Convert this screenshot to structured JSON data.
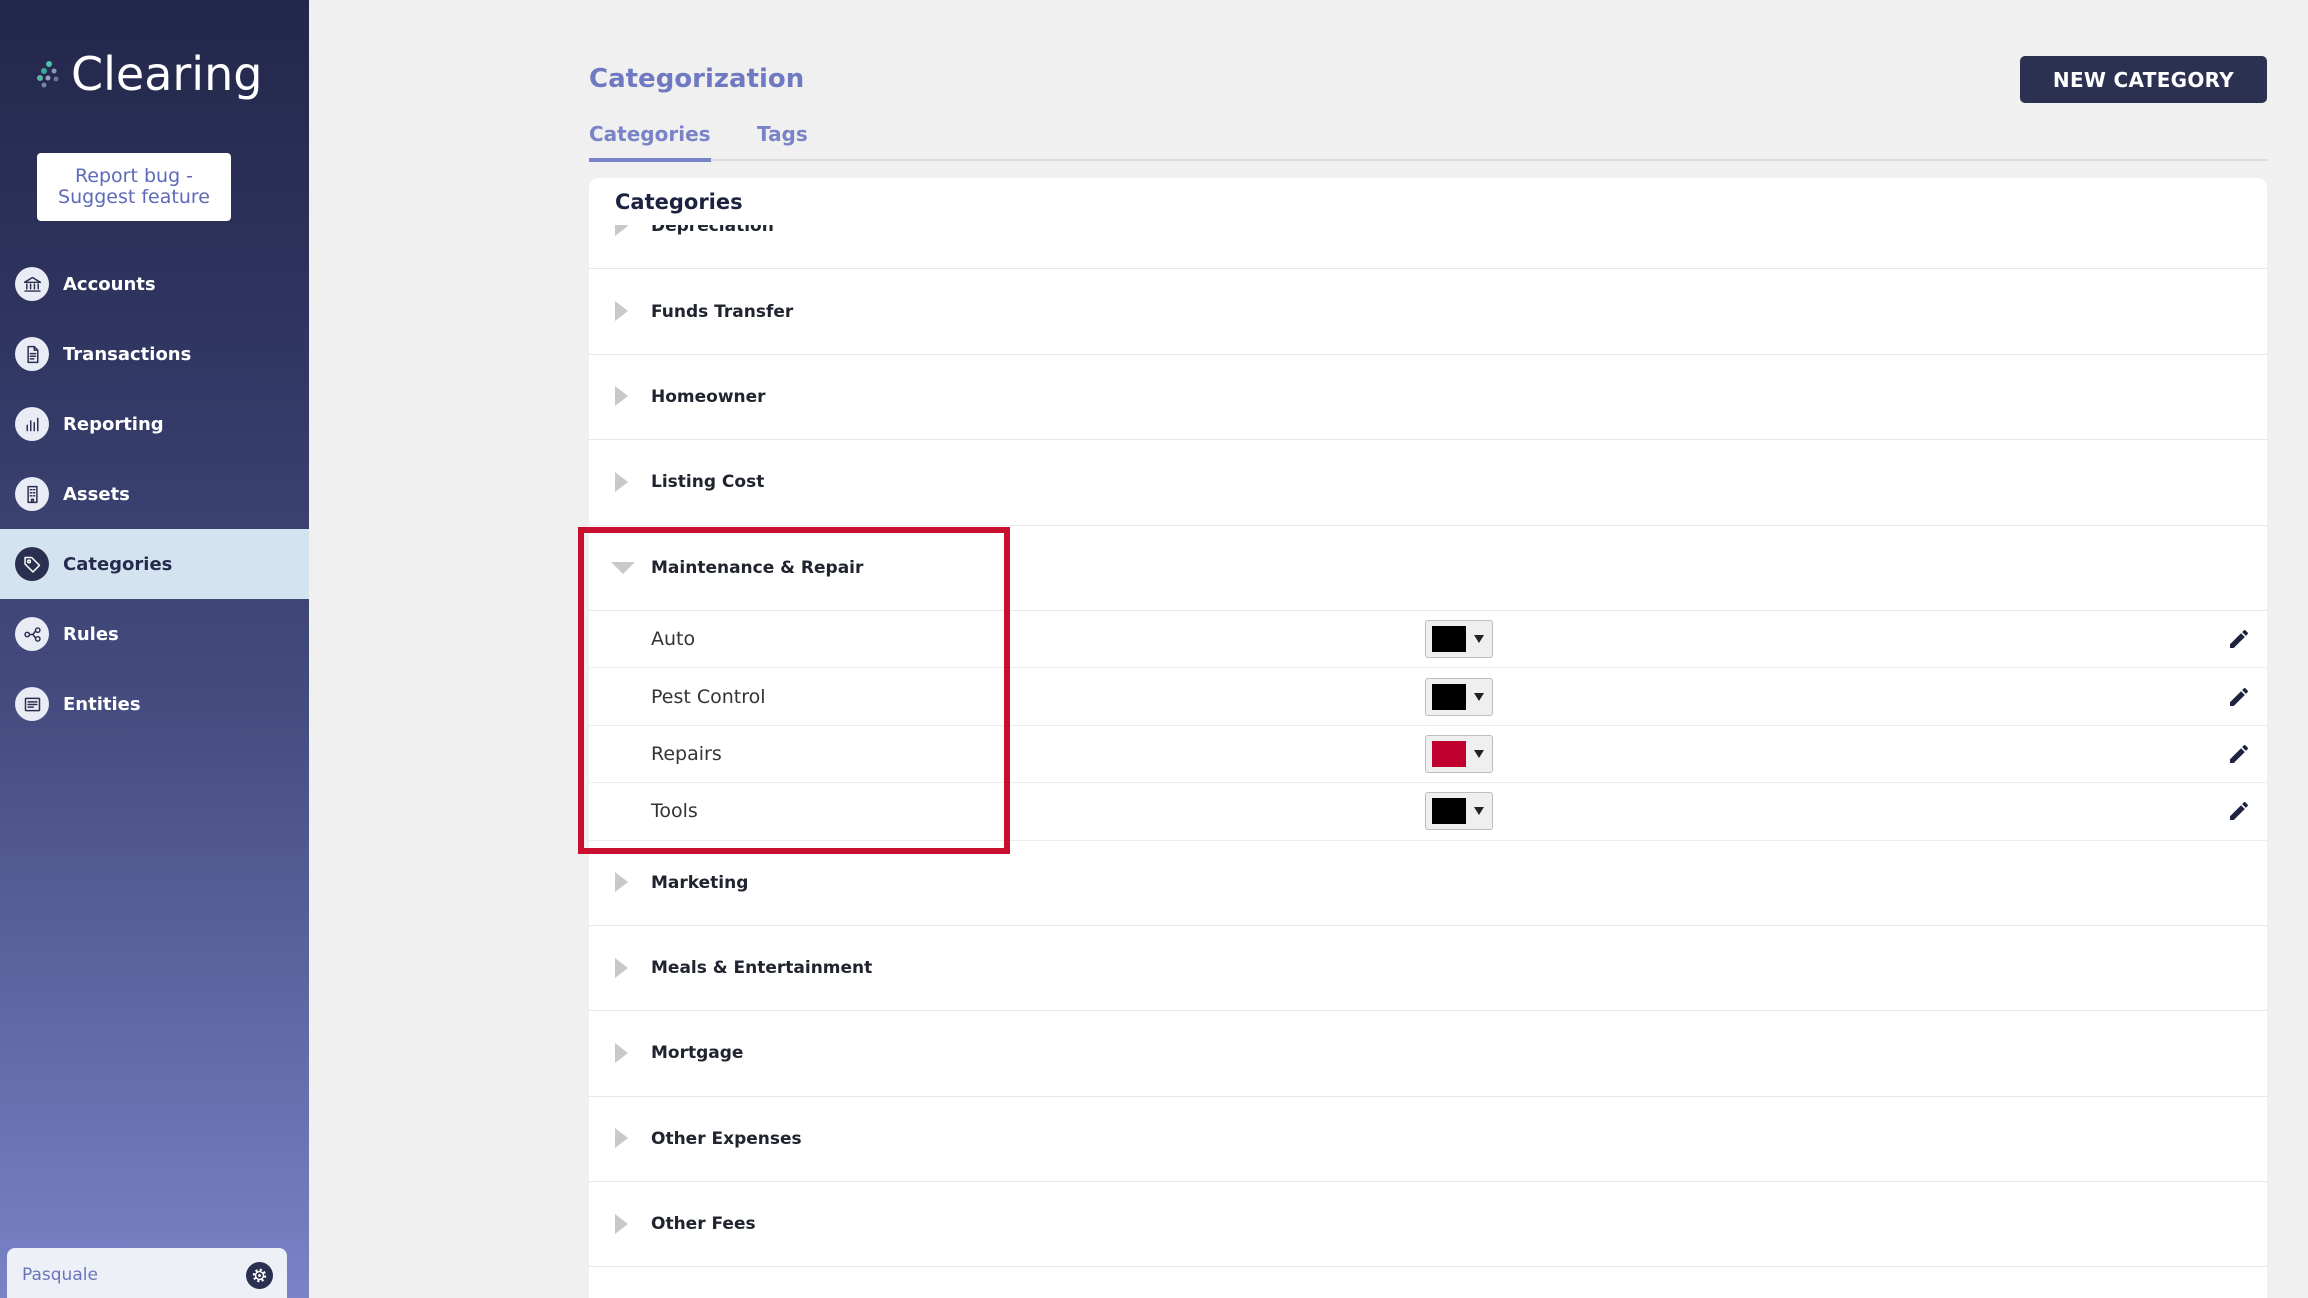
{
  "app": {
    "name": "Clearing"
  },
  "sidebar": {
    "feedback_button": "Report bug - Suggest feature",
    "items": [
      {
        "label": "Accounts",
        "icon": "bank-icon",
        "active": false
      },
      {
        "label": "Transactions",
        "icon": "document-icon",
        "active": false
      },
      {
        "label": "Reporting",
        "icon": "bar-chart-icon",
        "active": false
      },
      {
        "label": "Assets",
        "icon": "building-icon",
        "active": false
      },
      {
        "label": "Categories",
        "icon": "tag-icon",
        "active": true
      },
      {
        "label": "Rules",
        "icon": "rules-icon",
        "active": false
      },
      {
        "label": "Entities",
        "icon": "entities-icon",
        "active": false
      }
    ],
    "user": {
      "name": "Pasquale",
      "icon": "gear-icon"
    }
  },
  "header": {
    "title": "Categorization",
    "new_button": "NEW CATEGORY"
  },
  "tabs": [
    {
      "label": "Categories",
      "active": true
    },
    {
      "label": "Tags",
      "active": false
    }
  ],
  "card": {
    "title": "Categories",
    "rows": [
      {
        "name": "Depreciation",
        "expanded": false
      },
      {
        "name": "Funds Transfer",
        "expanded": false
      },
      {
        "name": "Homeowner",
        "expanded": false
      },
      {
        "name": "Listing Cost",
        "expanded": false
      },
      {
        "name": "Maintenance & Repair",
        "expanded": true,
        "highlighted": true,
        "children": [
          {
            "name": "Auto",
            "color": "#000000"
          },
          {
            "name": "Pest Control",
            "color": "#000000"
          },
          {
            "name": "Repairs",
            "color": "#c0002e"
          },
          {
            "name": "Tools",
            "color": "#000000"
          }
        ]
      },
      {
        "name": "Marketing",
        "expanded": false
      },
      {
        "name": "Meals & Entertainment",
        "expanded": false
      },
      {
        "name": "Mortgage",
        "expanded": false
      },
      {
        "name": "Other Expenses",
        "expanded": false
      },
      {
        "name": "Other Fees",
        "expanded": false
      }
    ]
  },
  "theme": {
    "accent": "#6f79c2",
    "navy": "#2b3050",
    "highlight": "#c8102e",
    "nav_active_bg": "#d4e3f0",
    "page_bg": "#f0f0f0"
  }
}
